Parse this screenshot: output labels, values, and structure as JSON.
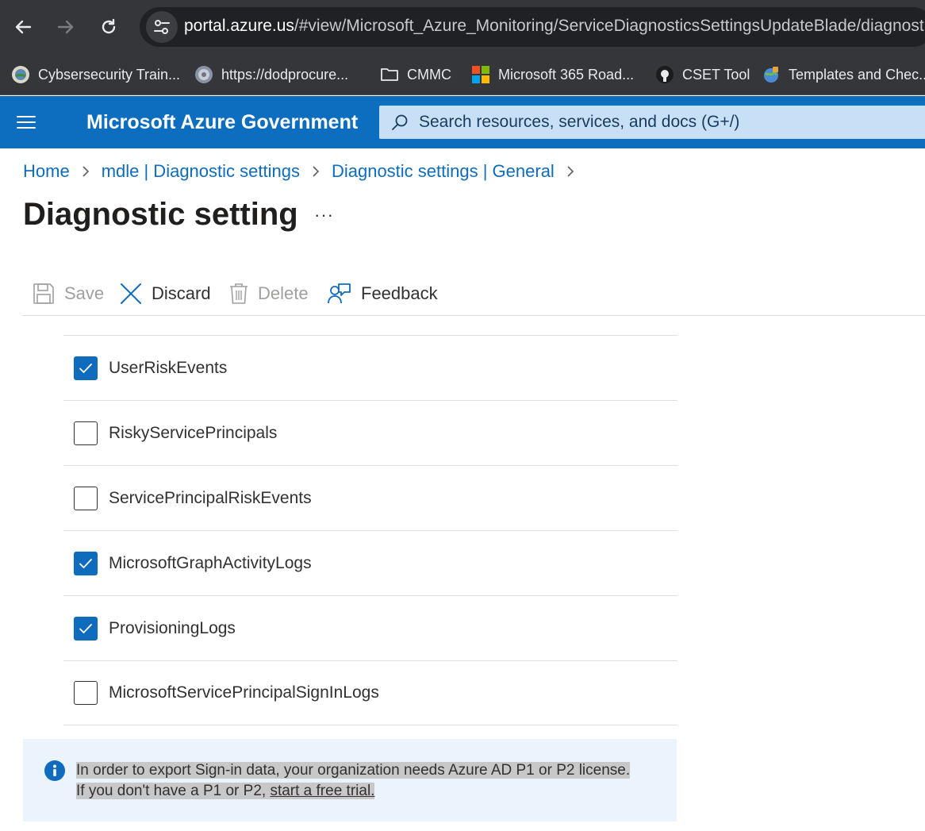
{
  "browser": {
    "url_host": "portal.azure.us",
    "url_path": "/#view/Microsoft_Azure_Monitoring/ServiceDiagnosticsSettingsUpdateBlade/diagnosti",
    "bookmarks": [
      {
        "label": "Cybsersecurity Train...",
        "icon": "globe-seal-icon"
      },
      {
        "label": "https://dodprocure...",
        "icon": "seal-icon"
      },
      {
        "label": "CMMC",
        "icon": "folder-icon"
      },
      {
        "label": "Microsoft 365 Road...",
        "icon": "microsoft-logo-icon"
      },
      {
        "label": "CSET Tool",
        "icon": "github-icon"
      },
      {
        "label": "Templates and Chec...",
        "icon": "puzzle-globe-icon"
      }
    ]
  },
  "header": {
    "brand": "Microsoft Azure Government",
    "search_placeholder": "Search resources, services, and docs (G+/)"
  },
  "breadcrumb": [
    "Home",
    "mdle | Diagnostic settings",
    "Diagnostic settings | General"
  ],
  "page": {
    "title": "Diagnostic setting",
    "more": "···"
  },
  "toolbar": {
    "save": "Save",
    "discard": "Discard",
    "delete": "Delete",
    "feedback": "Feedback"
  },
  "categories": [
    {
      "label": "UserRiskEvents",
      "checked": true
    },
    {
      "label": "RiskyServicePrincipals",
      "checked": false
    },
    {
      "label": "ServicePrincipalRiskEvents",
      "checked": false
    },
    {
      "label": "MicrosoftGraphActivityLogs",
      "checked": true
    },
    {
      "label": "ProvisioningLogs",
      "checked": true
    },
    {
      "label": "MicrosoftServicePrincipalSignInLogs",
      "checked": false
    }
  ],
  "info": {
    "line1": "In order to export Sign-in data, your organization needs Azure AD P1 or P2 license.",
    "line2_prefix": "If you don't have a P1 or P2, ",
    "link": "start a free trial."
  },
  "colors": {
    "azure_blue": "#0f6cbd",
    "info_bg": "#ebf3fc"
  }
}
